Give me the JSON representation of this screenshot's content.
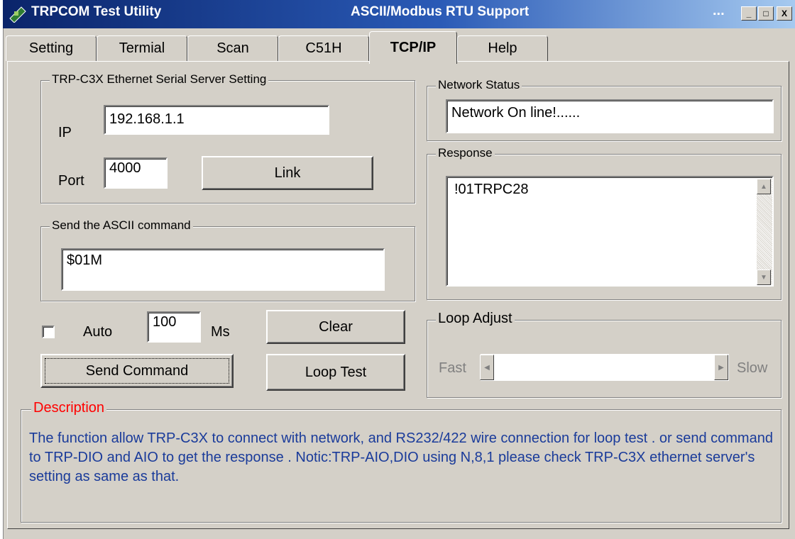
{
  "window": {
    "title": "TRPCOM Test Utility",
    "subtitle": "ASCII/Modbus RTU Support",
    "dots": "...",
    "min": "_",
    "max": "□",
    "close": "X"
  },
  "tabs": [
    {
      "label": "Setting"
    },
    {
      "label": "Termial"
    },
    {
      "label": "Scan"
    },
    {
      "label": "C51H"
    },
    {
      "label": "TCP/IP"
    },
    {
      "label": "Help"
    }
  ],
  "server": {
    "legend": "TRP-C3X Ethernet Serial Server Setting",
    "ip_label": "IP",
    "ip_value": "192.168.1.1",
    "port_label": "Port",
    "port_value": "4000",
    "link_button": "Link"
  },
  "ascii": {
    "legend": "Send the ASCII command",
    "command_value": "$01M"
  },
  "controls": {
    "auto_label": "Auto",
    "interval_value": "100",
    "ms_label": "Ms",
    "clear_button": "Clear",
    "send_button": "Send Command",
    "loop_button": "Loop Test"
  },
  "network": {
    "legend": "Network Status",
    "status_value": "Network On line!......"
  },
  "response": {
    "legend": "Response",
    "value": "!01TRPC28"
  },
  "loop": {
    "legend": "Loop Adjust",
    "fast_label": "Fast",
    "slow_label": "Slow"
  },
  "description": {
    "legend": "Description",
    "text": "The function allow TRP-C3X to connect with network, and RS232/422 wire connection for loop test . or send command to TRP-DIO and AIO  to get the response . Notic:TRP-AIO,DIO using N,8,1 please check TRP-C3X ethernet server's  setting  as same as that."
  },
  "colors": {
    "title_bar": "#0a246a",
    "description_legend": "#ff0000",
    "description_text": "#1a3b9a"
  }
}
